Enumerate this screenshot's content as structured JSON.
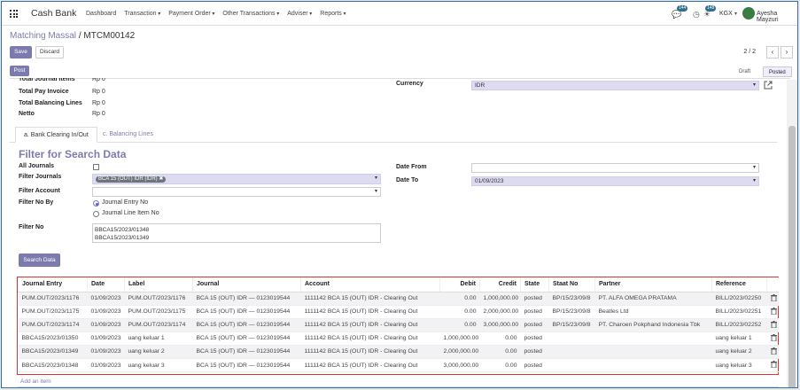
{
  "app": {
    "brand": "Cash Bank",
    "menu": [
      "Dashboard",
      "Transaction",
      "Payment Order",
      "Other Transactions",
      "Adviser",
      "Reports"
    ],
    "badges": {
      "chat": "144",
      "activity": "148"
    },
    "company": "KGX",
    "user": "Ayesha Mayzuri"
  },
  "breadcrumb": {
    "parent": "Matching Massal",
    "separator": "/",
    "current": "MTCM00142"
  },
  "buttons": {
    "save": "Save",
    "discard": "Discard",
    "post": "Post",
    "search": "Search Data"
  },
  "pager": {
    "value": "2 / 2",
    "prev": "‹",
    "next": "›"
  },
  "statuses": {
    "draft": "Draft",
    "posted": "Posted"
  },
  "summary": {
    "journal_items_label": "Total Journal Items",
    "journal_items_value": "Rp 0",
    "pay_invoice_label": "Total Pay Invoice",
    "pay_invoice_value": "Rp 0",
    "balancing_label": "Total Balancing Lines",
    "balancing_value": "Rp 0",
    "netto_label": "Netto",
    "netto_value": "Rp 0",
    "currency_label": "Currency",
    "currency_value": "IDR"
  },
  "tabs": [
    "a. Bank Clearing In/Out",
    "c. Balancing Lines"
  ],
  "filter": {
    "title": "Filter for Search Data",
    "all_journals_label": "All Journals",
    "filter_journals_label": "Filter Journals",
    "journal_tag": "BCA 15 (OUT) IDR (IDR)",
    "filter_account_label": "Filter Account",
    "filter_no_by_label": "Filter No By",
    "radio_1": "Journal Entry No",
    "radio_2": "Journal Line Item No",
    "filter_no_label": "Filter No",
    "filter_no_line1": "BBCA15/2023/01348",
    "filter_no_line2": "BBCA15/2023/01349",
    "date_from_label": "Date From",
    "date_from_value": "",
    "date_to_label": "Date To",
    "date_to_value": "01/09/2023"
  },
  "table": {
    "headers": [
      "Journal Entry",
      "Date",
      "Label",
      "Journal",
      "Account",
      "Debit",
      "Credit",
      "State",
      "Staat No",
      "Partner",
      "Reference"
    ],
    "rows": [
      [
        "PUM.OUT/2023/1176",
        "01/09/2023",
        "PUM.OUT/2023/1176",
        "BCA 15 (OUT) IDR — 0123019544",
        "1111142 BCA 15 (OUT) IDR - Clearing Out",
        "0.00",
        "1,000,000.00",
        "posted",
        "BP/15/23/09/8",
        "PT. ALFA OMEGA PRATAMA",
        "BILL/2023/02250"
      ],
      [
        "PUM.OUT/2023/1175",
        "01/09/2023",
        "PUM.OUT/2023/1175",
        "BCA 15 (OUT) IDR — 0123019544",
        "1111142 BCA 15 (OUT) IDR - Clearing Out",
        "0.00",
        "2,000,000.00",
        "posted",
        "BP/15/23/09/8",
        "Beatles Ltd",
        "BILL/2023/02251"
      ],
      [
        "PUM.OUT/2023/1174",
        "01/09/2023",
        "PUM.OUT/2023/1174",
        "BCA 15 (OUT) IDR — 0123019544",
        "1111142 BCA 15 (OUT) IDR - Clearing Out",
        "0.00",
        "3,000,000.00",
        "posted",
        "BP/15/23/09/8",
        "PT. Charoen Pokphand Indonesia Tbk",
        "BILL/2023/02252"
      ],
      [
        "BBCA15/2023/01350",
        "01/09/2023",
        "uang keluar 1",
        "BCA 15 (OUT) IDR — 0123019544",
        "1111142 BCA 15 (OUT) IDR - Clearing Out",
        "1,000,000.00",
        "0.00",
        "posted",
        "",
        "",
        "uang keluar 1"
      ],
      [
        "BBCA15/2023/01349",
        "01/09/2023",
        "uang keluar 2",
        "BCA 15 (OUT) IDR — 0123019544",
        "1111142 BCA 15 (OUT) IDR - Clearing Out",
        "2,000,000.00",
        "0.00",
        "posted",
        "",
        "",
        "uang keluar 2"
      ],
      [
        "BBCA15/2023/01348",
        "01/09/2023",
        "uang keluar 3",
        "BCA 15 (OUT) IDR — 0123019544",
        "1111142 BCA 15 (OUT) IDR - Clearing Out",
        "3,000,000.00",
        "0.00",
        "posted",
        "",
        "",
        "uang keluar 3"
      ]
    ],
    "add_line": "Add an item"
  },
  "icons": {
    "apps": "apps-grid-icon",
    "trash": "trash-icon",
    "external": "external-link-icon"
  },
  "colors": {
    "accent": "#7c7bad",
    "highlight_border": "#dd3333"
  }
}
